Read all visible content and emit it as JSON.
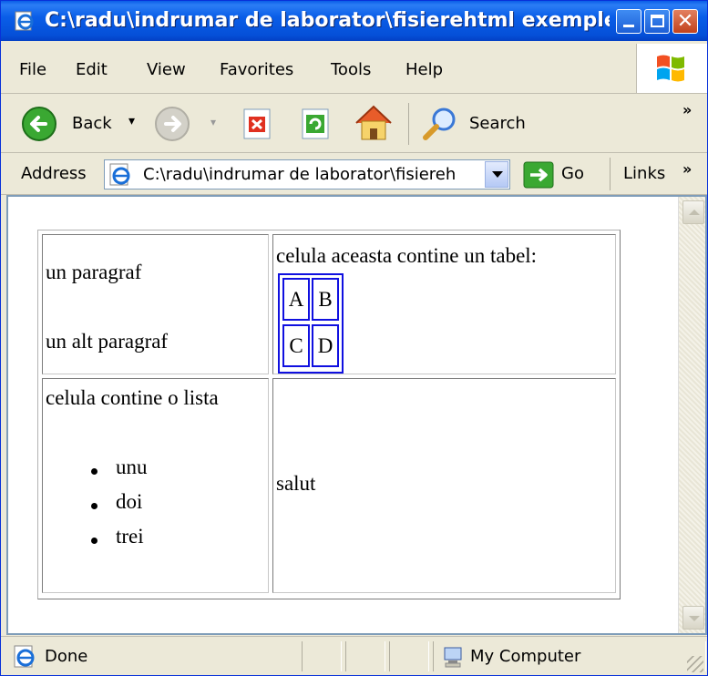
{
  "window": {
    "title": "C:\\radu\\indrumar de laborator\\fisierehtml exemple\\..."
  },
  "menu": {
    "items": [
      {
        "label": "File"
      },
      {
        "label": "Edit"
      },
      {
        "label": "View"
      },
      {
        "label": "Favorites"
      },
      {
        "label": "Tools"
      },
      {
        "label": "Help"
      }
    ]
  },
  "toolbar": {
    "back_label": "Back",
    "search_label": "Search"
  },
  "address": {
    "label": "Address",
    "value": "C:\\radu\\indrumar de laborator\\fisiereh",
    "go_label": "Go",
    "links_label": "Links"
  },
  "page": {
    "cell_1_1": {
      "para1": "un paragraf",
      "para2": "un alt paragraf"
    },
    "cell_1_2": {
      "text": "celula aceasta contine un tabel:",
      "inner": [
        "A",
        "B",
        "C",
        "D"
      ]
    },
    "cell_2_1": {
      "text": "celula contine o lista",
      "list": [
        "unu",
        "doi",
        "trei"
      ]
    },
    "cell_2_2": {
      "text": "salut"
    }
  },
  "status": {
    "text": "Done",
    "zone": "My Computer"
  },
  "colors": {
    "titlebar": "#0a5ee8",
    "chrome": "#ece9d8",
    "inner_table_border": "#1010e0"
  }
}
